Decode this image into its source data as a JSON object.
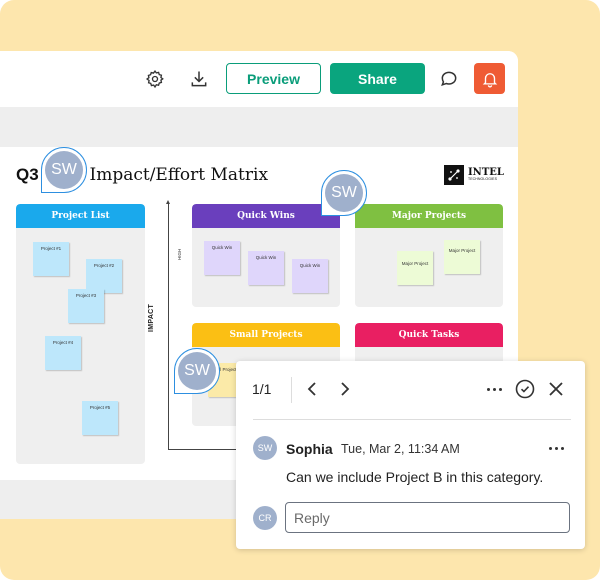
{
  "toolbar": {
    "icons": [
      "gear-icon",
      "download-icon",
      "comment-icon",
      "bell-icon"
    ],
    "preview_label": "Preview",
    "share_label": "Share"
  },
  "colors": {
    "background": "#fde6ad",
    "primary": "#0aa57e",
    "bell": "#ef5b34",
    "pin_border": "#2d8fe0",
    "avatar": "#9fb0cc"
  },
  "board": {
    "title_prefix": "Q3",
    "title": "Impact/Effort Matrix",
    "logo_main": "INTEL",
    "logo_sub": "TECHNOLOGIES",
    "axis_label": "IMPACT",
    "axis_sublabel": "HIGH",
    "project_list": {
      "title": "Project List",
      "color": "#1aa9ec",
      "items": [
        "Project #1",
        "Project #2",
        "Project #3",
        "Project #4",
        "Project #5"
      ]
    },
    "quadrants": [
      {
        "title": "Quick Wins",
        "color": "#6a3fbd",
        "items": [
          "Quick Win",
          "Quick Win",
          "Quick Win"
        ]
      },
      {
        "title": "Major Projects",
        "color": "#7fc041",
        "items": [
          "Major Project",
          "Major Project"
        ]
      },
      {
        "title": "Small Projects",
        "color": "#fbbf14",
        "items": [
          "Small Project"
        ]
      },
      {
        "title": "Quick Tasks",
        "color": "#e91f62",
        "items": []
      }
    ]
  },
  "pins": [
    {
      "initials": "SW"
    },
    {
      "initials": "SW"
    },
    {
      "initials": "SW"
    }
  ],
  "comment": {
    "counter": "1/1",
    "author_initials": "SW",
    "author": "Sophia",
    "timestamp": "Tue, Mar 2, 11:34 AM",
    "text": "Can we include Project B in this category.",
    "reply_initials": "CR",
    "reply_placeholder": "Reply"
  }
}
